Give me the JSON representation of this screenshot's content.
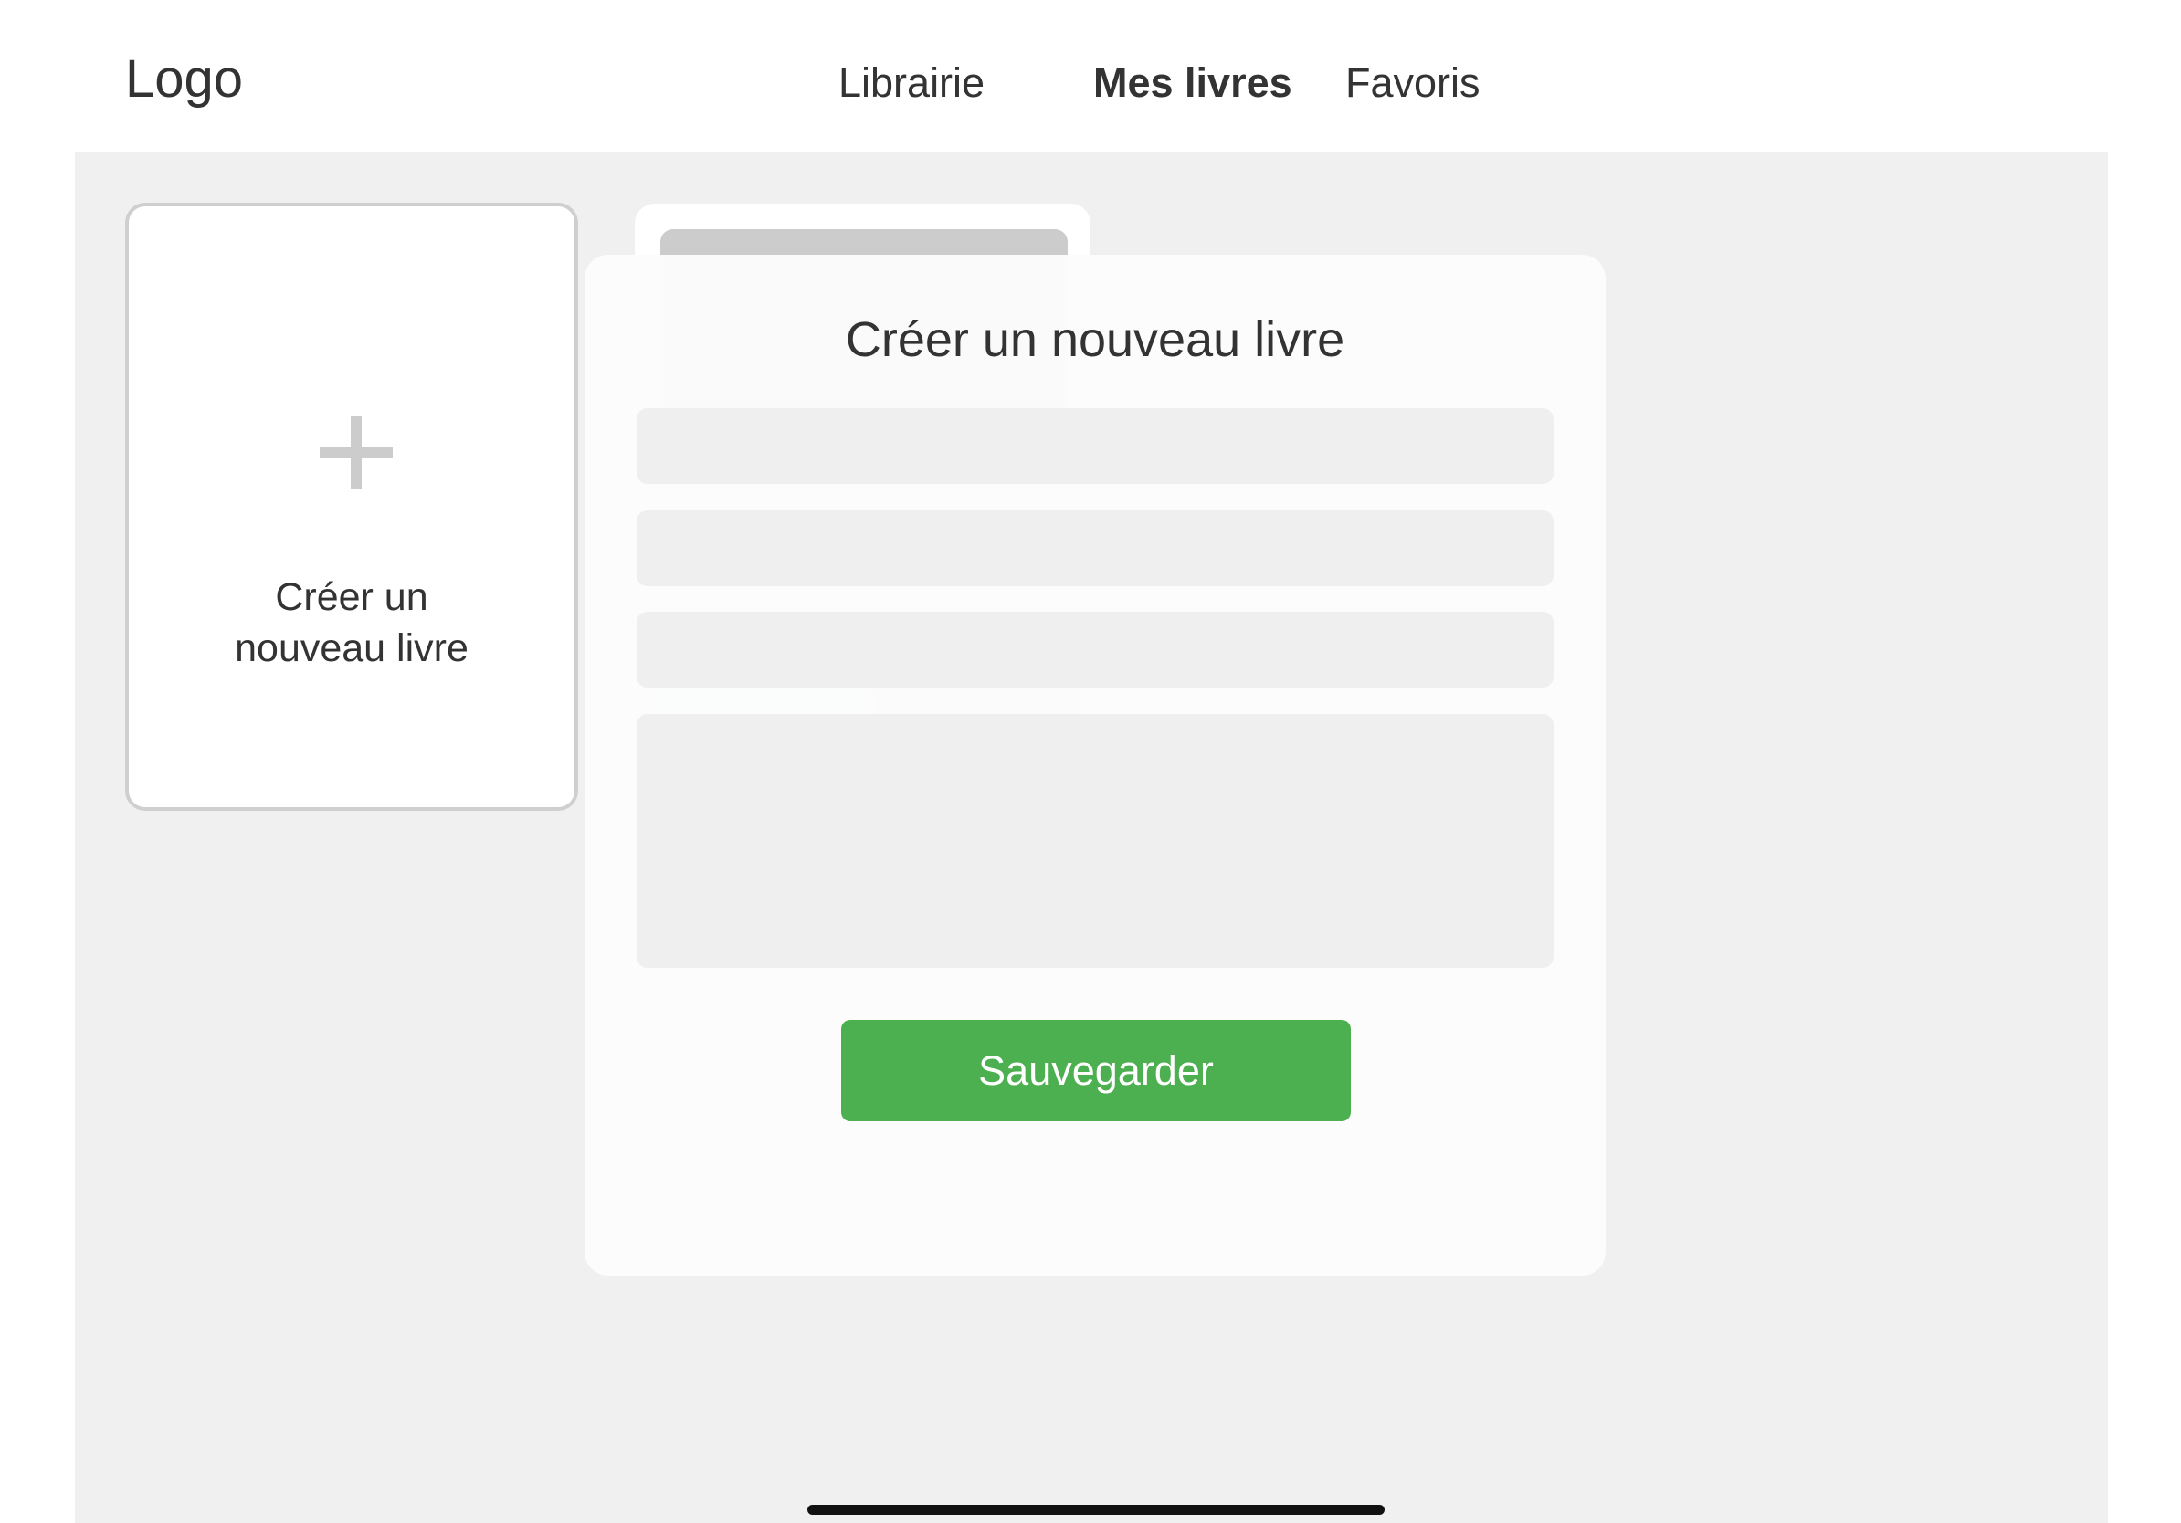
{
  "header": {
    "logo": "Logo",
    "nav": [
      {
        "label": "Librairie",
        "active": false
      },
      {
        "label": "Mes livres",
        "active": true
      },
      {
        "label": "Favoris",
        "active": false
      }
    ]
  },
  "library": {
    "new_book_card": {
      "icon": "plus-icon",
      "label": "Créer un\nnouveau livre"
    }
  },
  "modal": {
    "title": "Créer un nouveau livre",
    "fields": {
      "title": {
        "value": "",
        "placeholder": ""
      },
      "author": {
        "value": "",
        "placeholder": ""
      },
      "year": {
        "value": "",
        "placeholder": ""
      },
      "description": {
        "value": "",
        "placeholder": ""
      }
    },
    "save_label": "Sauvegarder"
  },
  "colors": {
    "accent": "#4caf50",
    "background": "#f0f0f0",
    "text": "#333333",
    "card_border": "#cfcfcf"
  }
}
